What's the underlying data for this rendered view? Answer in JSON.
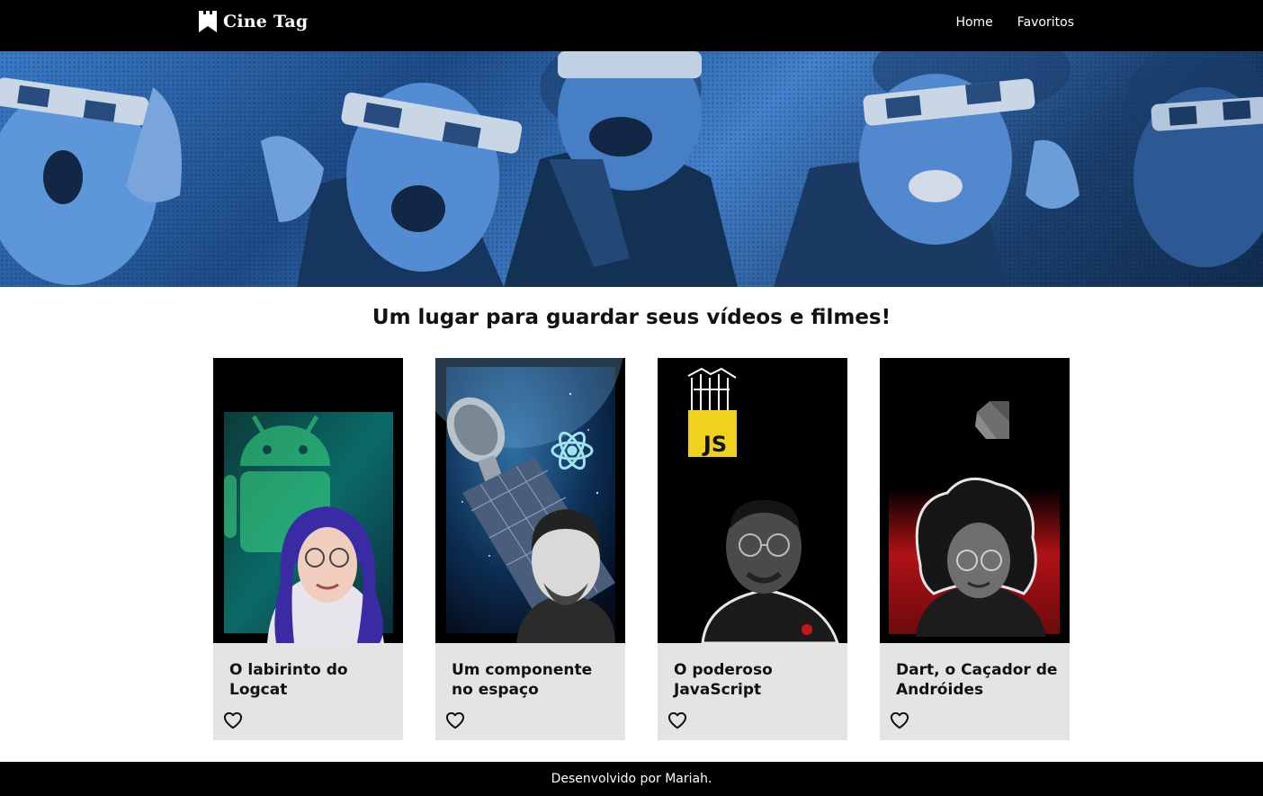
{
  "header": {
    "logo_text": "Cine Tag",
    "nav": [
      {
        "label": "Home"
      },
      {
        "label": "Favoritos"
      }
    ]
  },
  "banner": {
    "tint_color": "#3a7bd5"
  },
  "main": {
    "tagline": "Um lugar para guardar seus vídeos e filmes!",
    "videos": [
      {
        "title": "O labirinto do Logcat",
        "thumb_icon": "android-icon",
        "favorited": false
      },
      {
        "title": "Um componente no espaço",
        "thumb_icon": "react-icon",
        "favorited": false
      },
      {
        "title": "O poderoso JavaScript",
        "thumb_icon": "js-icon",
        "thumb_badge": "JS",
        "favorited": false
      },
      {
        "title": "Dart, o Caçador de Andróides",
        "thumb_icon": "dart-icon",
        "favorited": false
      }
    ]
  },
  "footer": {
    "text": "Desenvolvido por Mariah."
  },
  "colors": {
    "header_bg": "#000000",
    "card_bg": "#e4e4e4",
    "js_yellow": "#f0d21c",
    "android_green": "#3ddc84",
    "accent_red": "#c8161b"
  }
}
